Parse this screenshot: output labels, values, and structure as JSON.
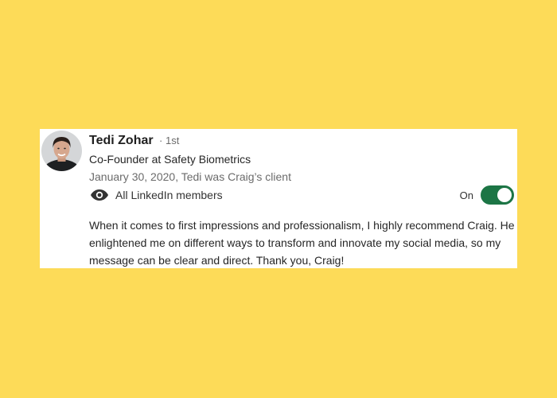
{
  "recommendation": {
    "author": {
      "name": "Tedi Zohar",
      "degree": "· 1st",
      "headline": "Co-Founder at Safety Biometrics",
      "relation": "January 30, 2020, Tedi was Craig’s client"
    },
    "visibility": {
      "icon": "eye-icon",
      "label": "All LinkedIn members"
    },
    "toggle": {
      "label": "On",
      "state": "on",
      "color": "#1C7545"
    },
    "text": "When it comes to first impressions and professionalism, I highly recommend Craig. He enlightened me on different ways to transform and innovate my social media, so my message can be clear and direct. Thank you, Craig!"
  },
  "colors": {
    "background": "#FDDB58",
    "card": "#FFFFFF"
  }
}
